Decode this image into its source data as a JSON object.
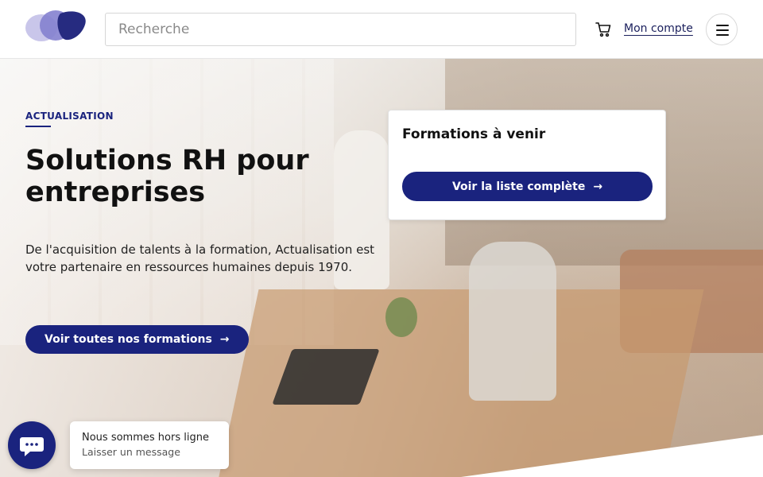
{
  "header": {
    "search_placeholder": "Recherche",
    "account_label": "Mon compte",
    "icons": {
      "cart": "cart-icon",
      "menu": "menu-icon",
      "logo": "logo-icon"
    }
  },
  "hero": {
    "eyebrow": "ACTUALISATION",
    "title": "Solutions RH pour entreprises",
    "lead": "De l'acquisition de talents à la formation, Actualisation est votre partenaire en ressources humaines depuis 1970.",
    "cta_label": "Voir toutes nos formations",
    "cta_arrow": "→"
  },
  "upcoming": {
    "title": "Formations à venir",
    "button_label": "Voir la liste complète",
    "button_arrow": "→"
  },
  "chat": {
    "status": "Nous sommes hors ligne",
    "subtitle": "Laisser un message",
    "icon": "chat-icon"
  },
  "colors": {
    "primary": "#1a237e",
    "logo_light": "#b3b0e0",
    "logo_mid": "#7b78c8",
    "logo_dark": "#2a2f86"
  }
}
